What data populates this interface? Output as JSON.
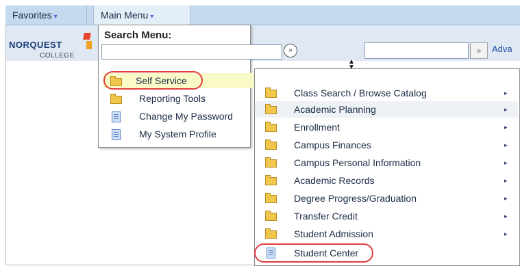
{
  "nav": {
    "favorites_label": "Favorites",
    "main_menu_label": "Main Menu",
    "chevron": "▾"
  },
  "header": {
    "logo_title": "NORQUEST",
    "logo_sub": "COLLEGE",
    "go_glyph": "»",
    "advanced_link": "Adva"
  },
  "main_menu": {
    "search_title": "Search Menu:",
    "search_value": "",
    "search_go_glyph": "»",
    "sort_glyph": "▲▼",
    "items": [
      {
        "label": "Self Service",
        "icon": "folder-icon"
      },
      {
        "label": "Reporting Tools",
        "icon": "folder-icon"
      },
      {
        "label": "Change My Password",
        "icon": "document-icon"
      },
      {
        "label": "My System Profile",
        "icon": "document-icon"
      }
    ]
  },
  "self_service_menu": {
    "arrow_glyph": "▸",
    "items": [
      {
        "label": "Class Search / Browse Catalog",
        "icon": "folder-icon",
        "has_submenu": true
      },
      {
        "label": "Academic Planning",
        "icon": "folder-icon",
        "has_submenu": true
      },
      {
        "label": "Enrollment",
        "icon": "folder-icon",
        "has_submenu": true
      },
      {
        "label": "Campus Finances",
        "icon": "folder-icon",
        "has_submenu": true
      },
      {
        "label": "Campus Personal Information",
        "icon": "folder-icon",
        "has_submenu": true
      },
      {
        "label": "Academic Records",
        "icon": "folder-icon",
        "has_submenu": true
      },
      {
        "label": "Degree Progress/Graduation",
        "icon": "folder-icon",
        "has_submenu": true
      },
      {
        "label": "Transfer Credit",
        "icon": "folder-icon",
        "has_submenu": true
      },
      {
        "label": "Student Admission",
        "icon": "folder-icon",
        "has_submenu": true
      },
      {
        "label": "Student Center",
        "icon": "document-icon",
        "has_submenu": false
      }
    ]
  },
  "colors": {
    "nav_bar": "#c5d9ef",
    "highlight": "#fafac8",
    "annotation_ring": "#e33b3b",
    "folder": "#f0c64b"
  }
}
